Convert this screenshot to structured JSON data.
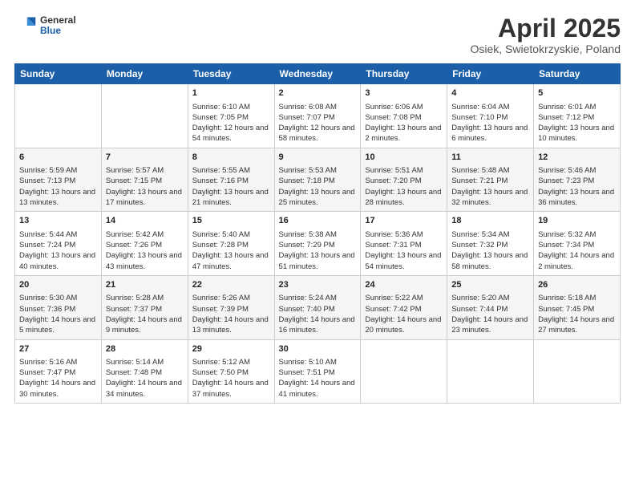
{
  "header": {
    "logo": {
      "general": "General",
      "blue": "Blue"
    },
    "title": "April 2025",
    "location": "Osiek, Swietokrzyskie, Poland"
  },
  "weekdays": [
    "Sunday",
    "Monday",
    "Tuesday",
    "Wednesday",
    "Thursday",
    "Friday",
    "Saturday"
  ],
  "weeks": [
    [
      {
        "day": "",
        "sunrise": "",
        "sunset": "",
        "daylight": ""
      },
      {
        "day": "",
        "sunrise": "",
        "sunset": "",
        "daylight": ""
      },
      {
        "day": "1",
        "sunrise": "Sunrise: 6:10 AM",
        "sunset": "Sunset: 7:05 PM",
        "daylight": "Daylight: 12 hours and 54 minutes."
      },
      {
        "day": "2",
        "sunrise": "Sunrise: 6:08 AM",
        "sunset": "Sunset: 7:07 PM",
        "daylight": "Daylight: 12 hours and 58 minutes."
      },
      {
        "day": "3",
        "sunrise": "Sunrise: 6:06 AM",
        "sunset": "Sunset: 7:08 PM",
        "daylight": "Daylight: 13 hours and 2 minutes."
      },
      {
        "day": "4",
        "sunrise": "Sunrise: 6:04 AM",
        "sunset": "Sunset: 7:10 PM",
        "daylight": "Daylight: 13 hours and 6 minutes."
      },
      {
        "day": "5",
        "sunrise": "Sunrise: 6:01 AM",
        "sunset": "Sunset: 7:12 PM",
        "daylight": "Daylight: 13 hours and 10 minutes."
      }
    ],
    [
      {
        "day": "6",
        "sunrise": "Sunrise: 5:59 AM",
        "sunset": "Sunset: 7:13 PM",
        "daylight": "Daylight: 13 hours and 13 minutes."
      },
      {
        "day": "7",
        "sunrise": "Sunrise: 5:57 AM",
        "sunset": "Sunset: 7:15 PM",
        "daylight": "Daylight: 13 hours and 17 minutes."
      },
      {
        "day": "8",
        "sunrise": "Sunrise: 5:55 AM",
        "sunset": "Sunset: 7:16 PM",
        "daylight": "Daylight: 13 hours and 21 minutes."
      },
      {
        "day": "9",
        "sunrise": "Sunrise: 5:53 AM",
        "sunset": "Sunset: 7:18 PM",
        "daylight": "Daylight: 13 hours and 25 minutes."
      },
      {
        "day": "10",
        "sunrise": "Sunrise: 5:51 AM",
        "sunset": "Sunset: 7:20 PM",
        "daylight": "Daylight: 13 hours and 28 minutes."
      },
      {
        "day": "11",
        "sunrise": "Sunrise: 5:48 AM",
        "sunset": "Sunset: 7:21 PM",
        "daylight": "Daylight: 13 hours and 32 minutes."
      },
      {
        "day": "12",
        "sunrise": "Sunrise: 5:46 AM",
        "sunset": "Sunset: 7:23 PM",
        "daylight": "Daylight: 13 hours and 36 minutes."
      }
    ],
    [
      {
        "day": "13",
        "sunrise": "Sunrise: 5:44 AM",
        "sunset": "Sunset: 7:24 PM",
        "daylight": "Daylight: 13 hours and 40 minutes."
      },
      {
        "day": "14",
        "sunrise": "Sunrise: 5:42 AM",
        "sunset": "Sunset: 7:26 PM",
        "daylight": "Daylight: 13 hours and 43 minutes."
      },
      {
        "day": "15",
        "sunrise": "Sunrise: 5:40 AM",
        "sunset": "Sunset: 7:28 PM",
        "daylight": "Daylight: 13 hours and 47 minutes."
      },
      {
        "day": "16",
        "sunrise": "Sunrise: 5:38 AM",
        "sunset": "Sunset: 7:29 PM",
        "daylight": "Daylight: 13 hours and 51 minutes."
      },
      {
        "day": "17",
        "sunrise": "Sunrise: 5:36 AM",
        "sunset": "Sunset: 7:31 PM",
        "daylight": "Daylight: 13 hours and 54 minutes."
      },
      {
        "day": "18",
        "sunrise": "Sunrise: 5:34 AM",
        "sunset": "Sunset: 7:32 PM",
        "daylight": "Daylight: 13 hours and 58 minutes."
      },
      {
        "day": "19",
        "sunrise": "Sunrise: 5:32 AM",
        "sunset": "Sunset: 7:34 PM",
        "daylight": "Daylight: 14 hours and 2 minutes."
      }
    ],
    [
      {
        "day": "20",
        "sunrise": "Sunrise: 5:30 AM",
        "sunset": "Sunset: 7:36 PM",
        "daylight": "Daylight: 14 hours and 5 minutes."
      },
      {
        "day": "21",
        "sunrise": "Sunrise: 5:28 AM",
        "sunset": "Sunset: 7:37 PM",
        "daylight": "Daylight: 14 hours and 9 minutes."
      },
      {
        "day": "22",
        "sunrise": "Sunrise: 5:26 AM",
        "sunset": "Sunset: 7:39 PM",
        "daylight": "Daylight: 14 hours and 13 minutes."
      },
      {
        "day": "23",
        "sunrise": "Sunrise: 5:24 AM",
        "sunset": "Sunset: 7:40 PM",
        "daylight": "Daylight: 14 hours and 16 minutes."
      },
      {
        "day": "24",
        "sunrise": "Sunrise: 5:22 AM",
        "sunset": "Sunset: 7:42 PM",
        "daylight": "Daylight: 14 hours and 20 minutes."
      },
      {
        "day": "25",
        "sunrise": "Sunrise: 5:20 AM",
        "sunset": "Sunset: 7:44 PM",
        "daylight": "Daylight: 14 hours and 23 minutes."
      },
      {
        "day": "26",
        "sunrise": "Sunrise: 5:18 AM",
        "sunset": "Sunset: 7:45 PM",
        "daylight": "Daylight: 14 hours and 27 minutes."
      }
    ],
    [
      {
        "day": "27",
        "sunrise": "Sunrise: 5:16 AM",
        "sunset": "Sunset: 7:47 PM",
        "daylight": "Daylight: 14 hours and 30 minutes."
      },
      {
        "day": "28",
        "sunrise": "Sunrise: 5:14 AM",
        "sunset": "Sunset: 7:48 PM",
        "daylight": "Daylight: 14 hours and 34 minutes."
      },
      {
        "day": "29",
        "sunrise": "Sunrise: 5:12 AM",
        "sunset": "Sunset: 7:50 PM",
        "daylight": "Daylight: 14 hours and 37 minutes."
      },
      {
        "day": "30",
        "sunrise": "Sunrise: 5:10 AM",
        "sunset": "Sunset: 7:51 PM",
        "daylight": "Daylight: 14 hours and 41 minutes."
      },
      {
        "day": "",
        "sunrise": "",
        "sunset": "",
        "daylight": ""
      },
      {
        "day": "",
        "sunrise": "",
        "sunset": "",
        "daylight": ""
      },
      {
        "day": "",
        "sunrise": "",
        "sunset": "",
        "daylight": ""
      }
    ]
  ]
}
